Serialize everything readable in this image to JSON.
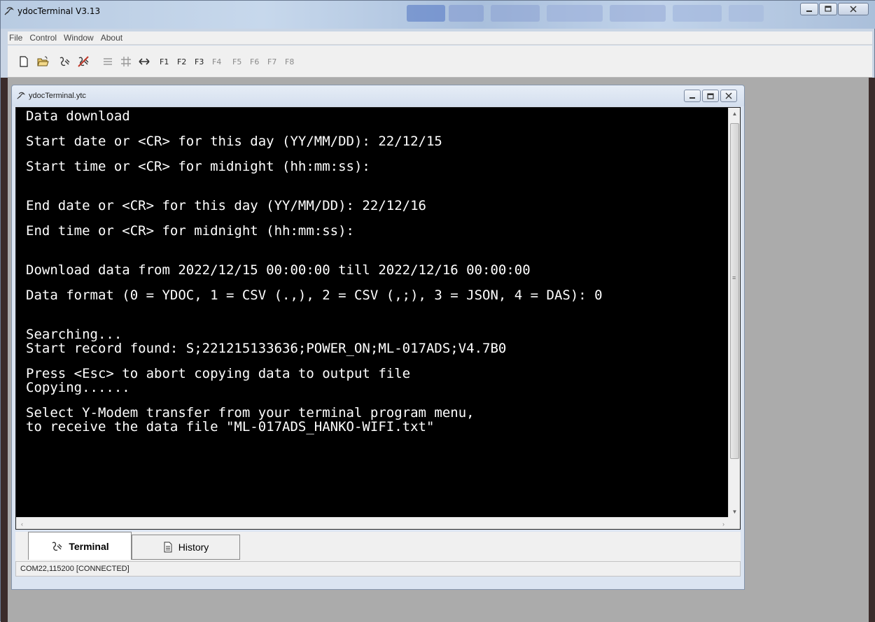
{
  "app": {
    "title": "ydocTerminal V3.13",
    "window_controls": [
      "minimize",
      "maximize",
      "close"
    ]
  },
  "menu": {
    "items": [
      "File",
      "Control",
      "Window",
      "About"
    ]
  },
  "toolbar": {
    "icons": [
      "new-document-icon",
      "open-folder-icon",
      "connect-icon",
      "disconnect-icon",
      "lines-icon",
      "hash-icon",
      "swap-arrows-icon"
    ],
    "fkeys": [
      {
        "label": "F1",
        "enabled": true
      },
      {
        "label": "F2",
        "enabled": true
      },
      {
        "label": "F3",
        "enabled": true
      },
      {
        "label": "F4",
        "enabled": false
      },
      {
        "label": "F5",
        "enabled": false
      },
      {
        "label": "F6",
        "enabled": false
      },
      {
        "label": "F7",
        "enabled": false
      },
      {
        "label": "F8",
        "enabled": false
      }
    ]
  },
  "child_window": {
    "title": "ydocTerminal.ytc"
  },
  "terminal": {
    "lines": {
      "l1": "Data download",
      "l2": "Start date or <CR> for this day (YY/MM/DD): 22/12/15",
      "l3": "Start time or <CR> for midnight (hh:mm:ss):",
      "l4": "End date or <CR> for this day (YY/MM/DD): 22/12/16",
      "l5": "End time or <CR> for midnight (hh:mm:ss):",
      "l6": "Download data from 2022/12/15 00:00:00 till 2022/12/16 00:00:00",
      "l7": "Data format (0 = YDOC, 1 = CSV (.,), 2 = CSV (,;), 3 = JSON, 4 = DAS): 0",
      "l8": "Searching...",
      "l9": "Start record found: S;221215133636;POWER_ON;ML-017ADS;V4.7B0",
      "l10": "Press <Esc> to abort copying data to output file",
      "l11": "Copying......",
      "l12": "Select Y-Modem transfer from your terminal program menu,",
      "l13": "to receive the data file \"ML-017ADS_HANKO-WIFI.txt\""
    }
  },
  "tabs": {
    "terminal": "Terminal",
    "history": "History",
    "active": "Terminal"
  },
  "status": {
    "text": "COM22,115200 [CONNECTED]"
  }
}
